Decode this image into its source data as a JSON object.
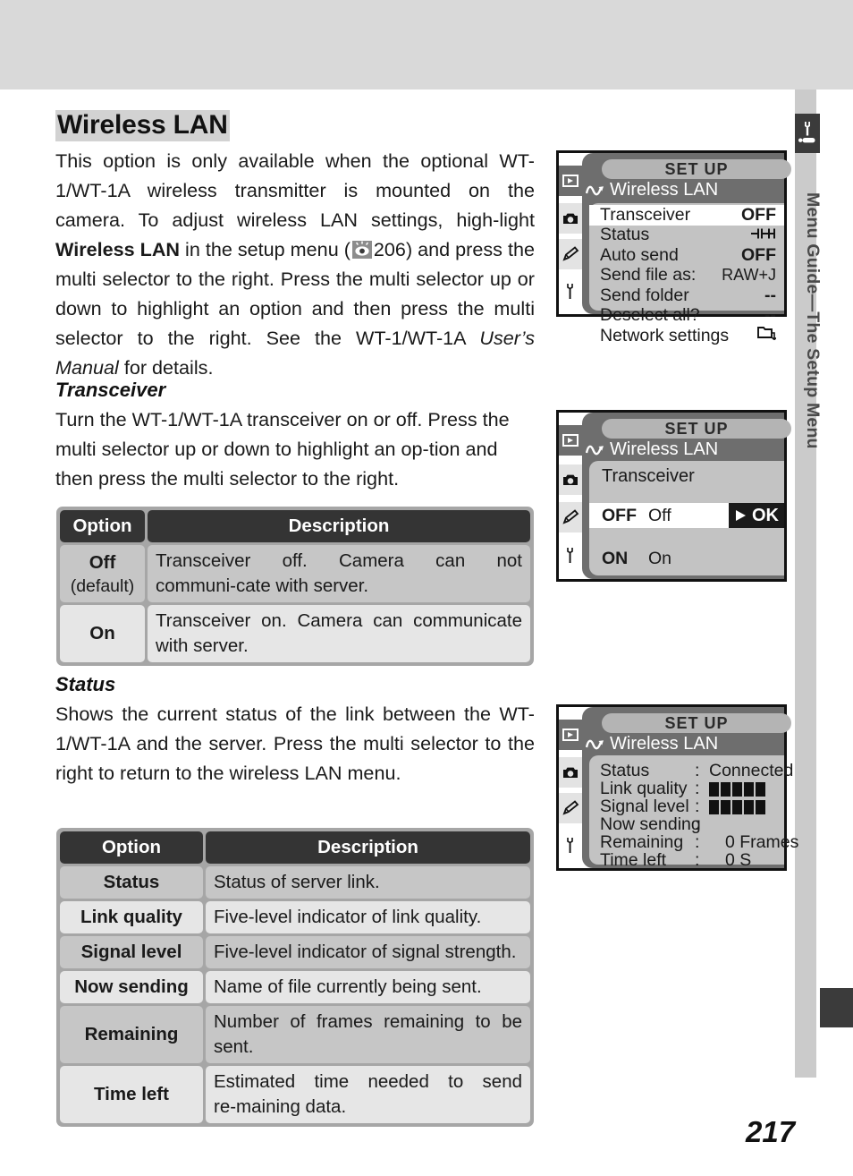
{
  "sidebar": {
    "label": "Menu Guide—The Setup Menu",
    "icon": "wrench-icon"
  },
  "page_number": "217",
  "heading": "Wireless LAN",
  "intro_paragraph": {
    "part1": "This option is only available when the optional WT-1/WT-1A wireless transmitter is mounted on the camera.  To adjust wireless LAN settings, high‑light ",
    "bold1": "Wireless LAN",
    "part2": " in the setup menu (",
    "ref_icon": "eye-page-reference-icon",
    "ref_page": "206",
    "part3": ") and press the multi selector to the right.  Press the multi selector up or down to highlight an option and then press the multi selector to the right.  See the WT-1/WT-1A ",
    "italic1": "User’s Manual",
    "part4": " for details."
  },
  "transceiver_section": {
    "heading": "Transceiver",
    "body": "Turn the WT-1/WT-1A transceiver on or off.  Press the multi selector up or down to highlight an op‑tion and then press the multi selector to the right.",
    "table": {
      "headers": [
        "Option",
        "Description"
      ],
      "rows": [
        {
          "option": "Off",
          "option_sub": "(default)",
          "description": "Transceiver off.  Camera can not communi‑cate with server."
        },
        {
          "option": "On",
          "option_sub": "",
          "description": "Transceiver on.  Camera can communicate with server."
        }
      ]
    }
  },
  "status_section": {
    "heading": "Status",
    "body": "Shows the current status of the link between the WT-1/WT-1A and the server.  Press the multi selector to the right to return to the wireless LAN menu.",
    "table": {
      "headers": [
        "Option",
        "Description"
      ],
      "rows": [
        {
          "option": "Status",
          "description": "Status of server link."
        },
        {
          "option": "Link quality",
          "description": "Five-level indicator of link quality."
        },
        {
          "option": "Signal level",
          "description": "Five-level indicator of signal strength."
        },
        {
          "option": "Now sending",
          "description": "Name of file currently being sent."
        },
        {
          "option": "Remaining",
          "description": "Number of frames remaining to be sent."
        },
        {
          "option": "Time left",
          "description": "Estimated time needed to send re‑maining data."
        }
      ]
    }
  },
  "lcd_screens": [
    {
      "name": "wireless-lan-menu",
      "titlebar": "SET  UP",
      "menu_title": "Wireless LAN",
      "rail_icons": [
        "playback-icon",
        "camera-icon",
        "pencil-icon",
        "wrench-icon"
      ],
      "items": [
        {
          "label": "Transceiver",
          "value": "OFF",
          "highlighted": true
        },
        {
          "label": "Status",
          "value": "link-symbol",
          "highlighted": false
        },
        {
          "label": "Auto send",
          "value": "OFF",
          "highlighted": false
        },
        {
          "label": "Send file as:",
          "value": "RAW+J",
          "highlighted": false
        },
        {
          "label": "Send folder",
          "value": "--",
          "highlighted": false
        },
        {
          "label": "Deselect all?",
          "value": "--",
          "highlighted": false
        },
        {
          "label": "Network settings",
          "value": "folder-icon",
          "highlighted": false
        }
      ]
    },
    {
      "name": "transceiver-select",
      "titlebar": "SET  UP",
      "menu_title": "Wireless LAN",
      "panel_title": "Transceiver",
      "options": [
        {
          "code": "OFF",
          "label": "Off",
          "selected": true,
          "ok_label": "OK"
        },
        {
          "code": "ON",
          "label": "On",
          "selected": false
        }
      ]
    },
    {
      "name": "status-display",
      "titlebar": "SET  UP",
      "menu_title": "Wireless LAN",
      "rows": [
        {
          "label": "Status",
          "sep": ":",
          "value": "Connected",
          "type": "text"
        },
        {
          "label": "Link quality",
          "sep": ":",
          "value": "5",
          "type": "bars"
        },
        {
          "label": "Signal level",
          "sep": ":",
          "value": "5",
          "type": "bars"
        },
        {
          "label": "Now sending",
          "sep": ":",
          "value": "",
          "type": "text"
        },
        {
          "label": "Remaining",
          "sep": ":",
          "value": "0 Frames",
          "type": "text"
        },
        {
          "label": "Time left",
          "sep": ":",
          "value": "0 S",
          "type": "text"
        }
      ]
    }
  ]
}
